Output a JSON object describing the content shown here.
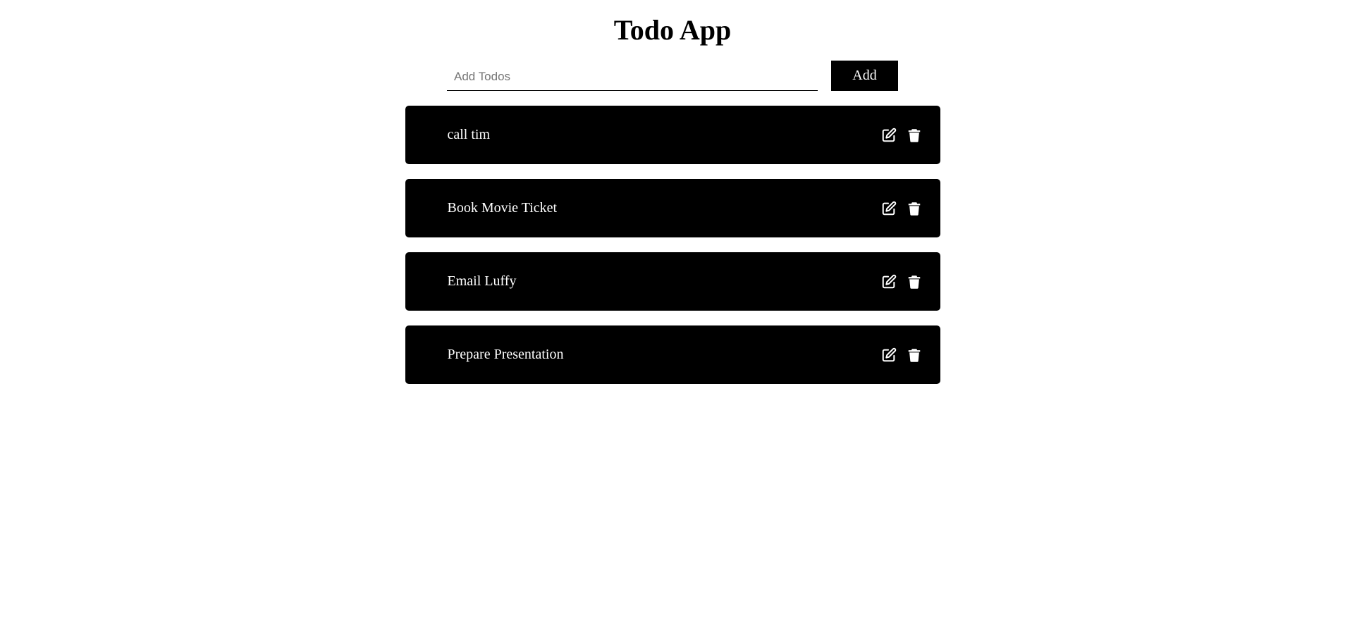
{
  "app": {
    "title": "Todo App"
  },
  "add_form": {
    "input_value": "",
    "input_placeholder": "Add Todos",
    "add_label": "Add"
  },
  "todos": [
    {
      "text": "call tim",
      "edit_icon": "edit-icon",
      "delete_icon": "trash-icon"
    },
    {
      "text": "Book Movie Ticket",
      "edit_icon": "edit-icon",
      "delete_icon": "trash-icon"
    },
    {
      "text": "Email Luffy",
      "edit_icon": "edit-icon",
      "delete_icon": "trash-icon"
    },
    {
      "text": "Prepare Presentation",
      "edit_icon": "edit-icon",
      "delete_icon": "trash-icon"
    }
  ],
  "colors": {
    "background": "#ffffff",
    "item_background": "#000000",
    "item_text": "#ffffff",
    "button_background": "#000000",
    "button_text": "#ffffff"
  }
}
